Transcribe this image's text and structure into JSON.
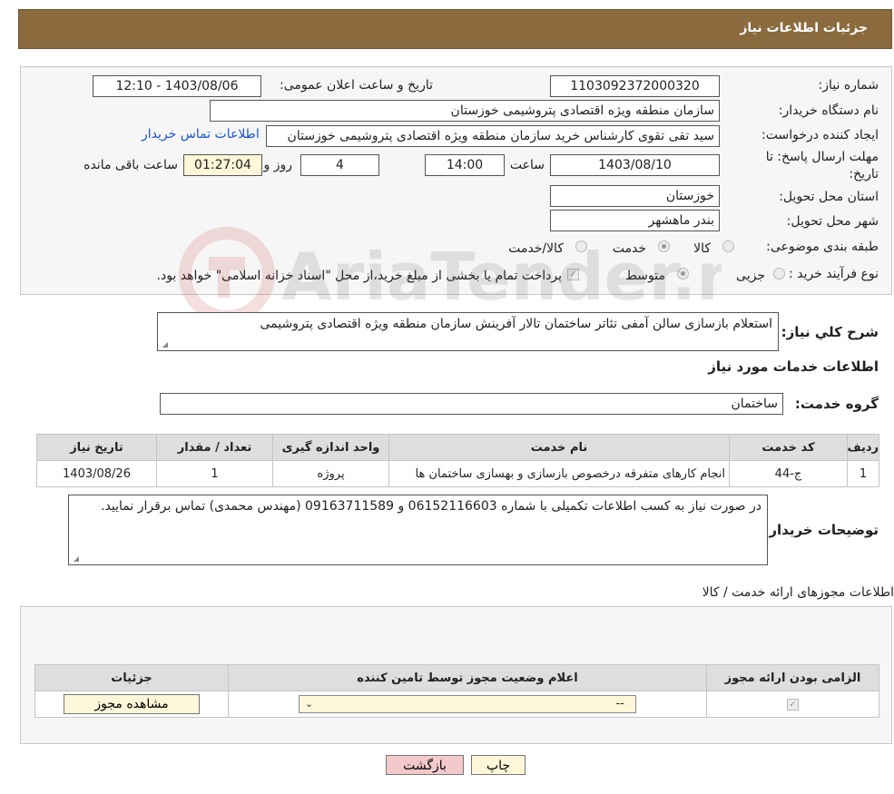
{
  "header": {
    "title": "جزئیات اطلاعات نیاز"
  },
  "form": {
    "need_number_label": "شماره نیاز:",
    "need_number": "1103092372000320",
    "announce_label": "تاریخ و ساعت اعلان عمومی:",
    "announce_value": "1403/08/06 - 12:10",
    "buyer_org_label": "نام دستگاه خریدار:",
    "buyer_org": "سازمان منطقه ویژه اقتصادی پتروشیمی خوزستان",
    "requester_label": "ایجاد کننده درخواست:",
    "requester": "سید تقی تقوی کارشناس خرید سازمان منطقه ویژه اقتصادی پتروشیمی خوزستان",
    "contact_link": "اطلاعات تماس خریدار",
    "deadline_label_1": "مهلت ارسال پاسخ: تا",
    "deadline_label_2": "تاریخ:",
    "deadline_date": "1403/08/10",
    "time_label": "ساعت",
    "deadline_time": "14:00",
    "days_value": "4",
    "days_label": "روز و",
    "remaining_time": "01:27:04",
    "remaining_label": "ساعت باقی مانده",
    "province_label": "استان محل تحویل:",
    "province": "خوزستان",
    "city_label": "شهر محل تحویل:",
    "city": "بندر ماهشهر",
    "category_label": "طبقه بندی موضوعی:",
    "category_options": [
      "کالا",
      "خدمت",
      "کالا/خدمت"
    ],
    "category_selected": "خدمت",
    "process_label": "نوع فرآیند خرید :",
    "process_options": [
      "جزیی",
      "متوسط"
    ],
    "process_selected": "متوسط",
    "treasury_note": "پرداخت تمام یا بخشی از مبلغ خرید،از محل \"اسناد خزانه اسلامی\" خواهد بود."
  },
  "summary": {
    "label": "شرح کلي نياز:",
    "text": "استعلام بازسازی سالن آمفی تئاتر ساختمان تالار آفرینش سازمان منطقه ویژه اقتصادی پتروشیمی"
  },
  "services": {
    "section_title": "اطلاعات خدمات مورد نیاز",
    "group_label": "گروه خدمت:",
    "group_value": "ساختمان",
    "columns": [
      "ردیف",
      "کد خدمت",
      "نام خدمت",
      "واحد اندازه گیری",
      "تعداد / مقدار",
      "تاریخ نیاز"
    ],
    "rows": [
      [
        "1",
        "ج-44",
        "انجام کارهای متفرقه درخصوص بازسازی و بهسازی ساختمان ها",
        "پروژه",
        "1",
        "1403/08/26"
      ]
    ]
  },
  "buyer_notes": {
    "label": "توضیحات خریدار:",
    "text": "در صورت نیاز به کسب اطلاعات تکمیلی با شماره 06152116603 و 09163711589 (مهندس محمدی) تماس برقرار نمایید."
  },
  "permits": {
    "section_title": "اطلاعات مجوزهای ارائه خدمت / کالا",
    "columns": [
      "الزامی بودن ارائه مجوز",
      "اعلام وضعیت مجوز توسط تامین کننده",
      "جزئیات"
    ],
    "select_value": "--",
    "view_button": "مشاهده مجوز"
  },
  "buttons": {
    "print": "چاپ",
    "back": "بازگشت"
  },
  "colors": {
    "header_bg": "#8b6b3e",
    "link": "#1a55c9",
    "back_btn": "#f3c9cc"
  }
}
